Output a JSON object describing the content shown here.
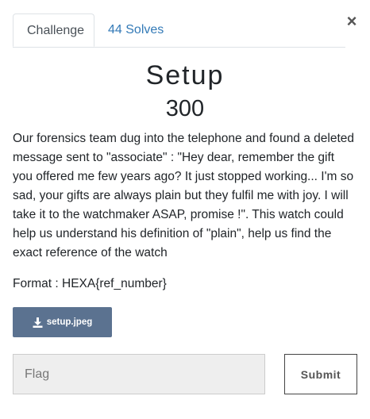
{
  "modal": {
    "close_label": "×"
  },
  "tabs": [
    {
      "label": "Challenge",
      "active": true
    },
    {
      "label": "44 Solves",
      "active": false
    }
  ],
  "challenge": {
    "name": "Setup",
    "value": "300",
    "description": "Our forensics team dug into the telephone and found a deleted message sent to \"associate\" : \"Hey dear, remember the gift you offered me few years ago? It just stopped working... I'm so sad, your gifts are always plain but they fulfil me with joy. I will take it to the watchmaker ASAP, promise !\". This watch could help us understand his definition of \"plain\", help us find the exact reference of the watch",
    "format": "Format : HEXA{ref_number}"
  },
  "file": {
    "name": "setup.jpeg",
    "icon": "download-icon"
  },
  "submission": {
    "placeholder": "Flag",
    "value": "",
    "submit_label": "Submit"
  },
  "colors": {
    "tab_link": "#337ab7",
    "file_button": "#5b7290",
    "input_background": "#eeeeee"
  }
}
